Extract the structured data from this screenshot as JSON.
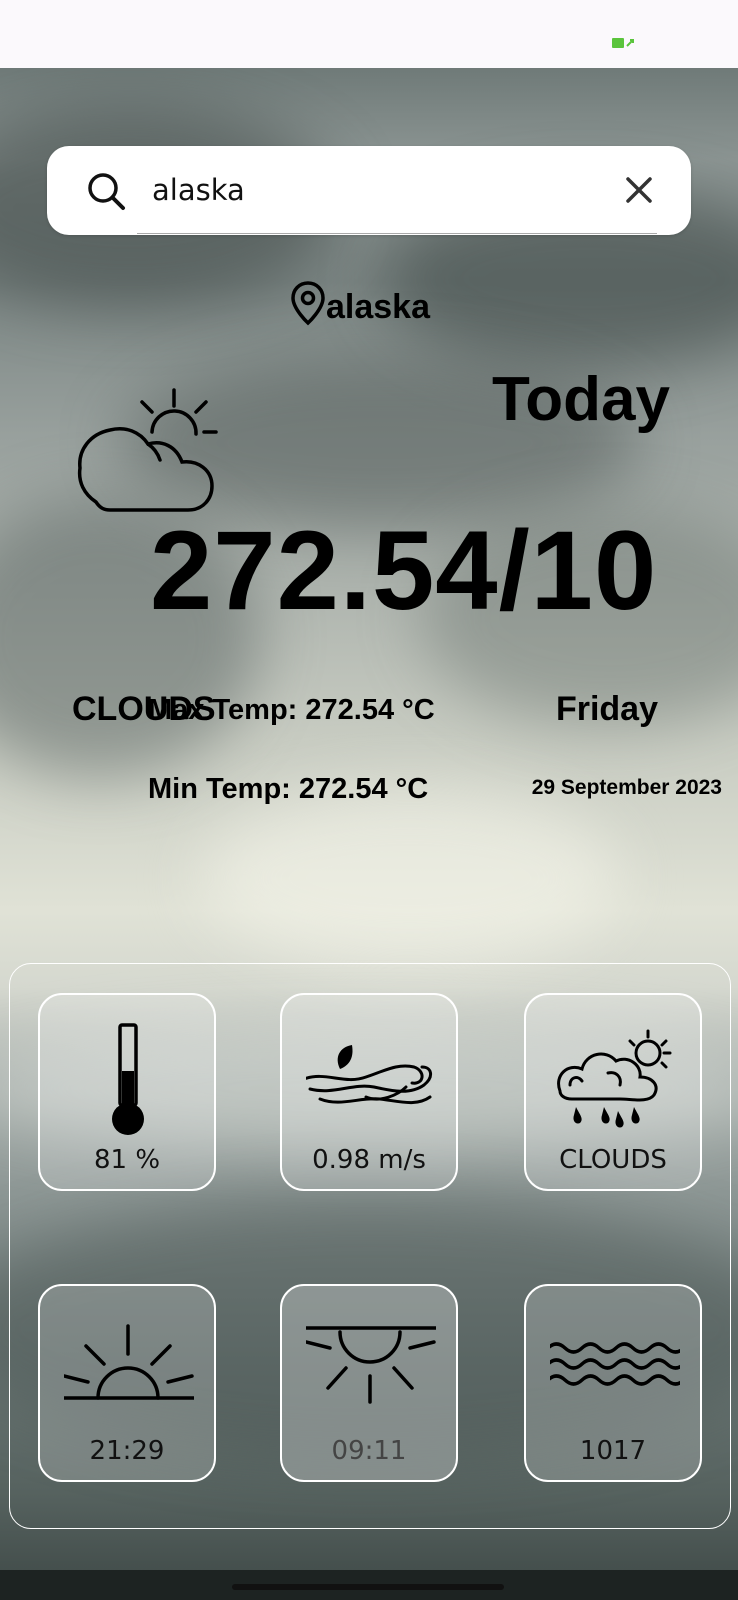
{
  "search": {
    "value": "alaska"
  },
  "location": {
    "name": "alaska"
  },
  "today_label": "Today",
  "main_temp": "272.54/10",
  "condition": "CLOUDS",
  "max_temp": "Max Temp: 272.54 °C",
  "min_temp": "Min Temp: 272.54 °C",
  "day_name": "Friday",
  "date": "29 September 2023",
  "details": {
    "humidity": {
      "value": "81 %",
      "icon": "thermometer-icon"
    },
    "wind": {
      "value": "0.98 m/s",
      "icon": "wind-icon"
    },
    "condition": {
      "value": "CLOUDS",
      "icon": "cloud-rain-sun-icon"
    },
    "sunset": {
      "value": "21:29",
      "icon": "sunrise-icon"
    },
    "sunrise": {
      "value": "09:11",
      "icon": "sunset-icon"
    },
    "pressure": {
      "value": "1017",
      "icon": "waves-icon"
    }
  },
  "colors": {
    "battery": "#5ac43c",
    "tile_border": "#ffffff"
  }
}
